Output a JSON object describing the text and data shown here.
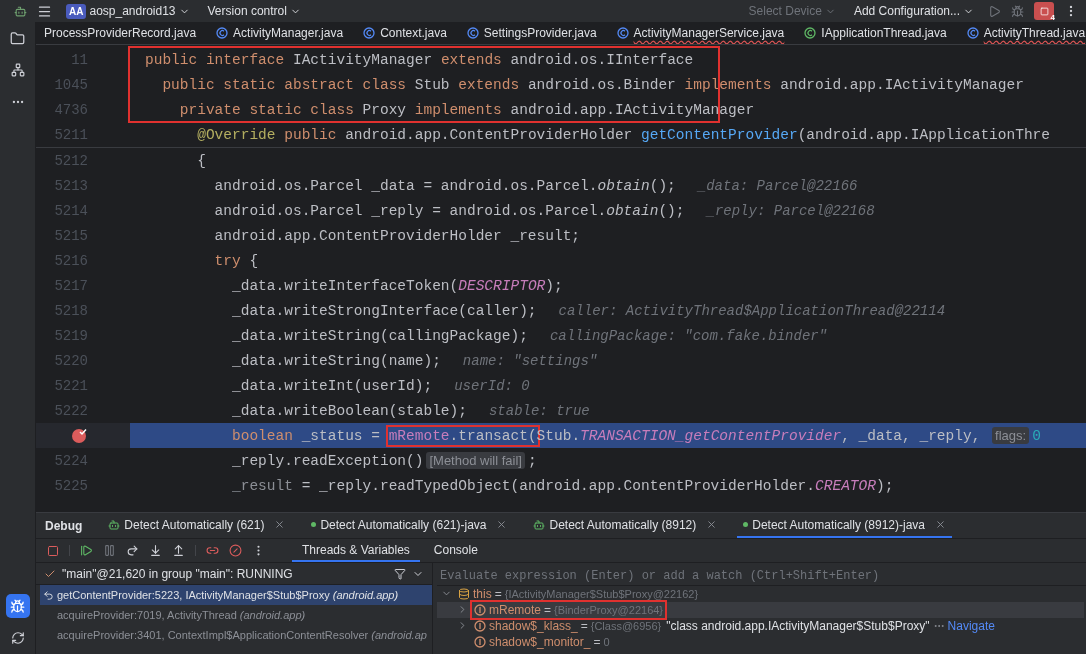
{
  "top_bar": {
    "project": {
      "badge": "AA",
      "name": "aosp_android13"
    },
    "vcs": "Version control",
    "device": {
      "label": "Select Device",
      "disabled": true
    },
    "run_config": "Add Configuration...",
    "debug_count": "4"
  },
  "file_tabs": [
    {
      "label": "ProcessProviderRecord.java",
      "kind": "none",
      "errors": false
    },
    {
      "label": "ActivityManager.java",
      "kind": "class",
      "errors": false
    },
    {
      "label": "Context.java",
      "kind": "class",
      "errors": false
    },
    {
      "label": "SettingsProvider.java",
      "kind": "class",
      "errors": false
    },
    {
      "label": "ActivityManagerService.java",
      "kind": "class",
      "errors": true
    },
    {
      "label": "IApplicationThread.java",
      "kind": "interface",
      "errors": false
    },
    {
      "label": "ActivityThread.java",
      "kind": "class",
      "errors": true
    }
  ],
  "editor": {
    "sticky_lines": [
      {
        "number": "11",
        "annotated": true,
        "tokens": [
          {
            "kind": "kw",
            "text": "public interface "
          },
          {
            "kind": "plain",
            "text": "IActivityManager "
          },
          {
            "kind": "kw",
            "text": "extends "
          },
          {
            "kind": "plain",
            "text": "android.os.IInterface"
          }
        ]
      },
      {
        "number": "1045",
        "annotated": true,
        "tokens": [
          {
            "kind": "kw",
            "text": "  public static abstract class "
          },
          {
            "kind": "plain",
            "text": "Stub "
          },
          {
            "kind": "kw",
            "text": "extends "
          },
          {
            "kind": "plain",
            "text": "android.os.Binder "
          },
          {
            "kind": "kw",
            "text": "implements "
          },
          {
            "kind": "plain",
            "text": "android.app.IActivityManager"
          }
        ]
      },
      {
        "number": "4736",
        "annotated": true,
        "tokens": [
          {
            "kind": "kw",
            "text": "    private static class "
          },
          {
            "kind": "plain",
            "text": "Proxy "
          },
          {
            "kind": "kw",
            "text": "implements "
          },
          {
            "kind": "plain",
            "text": "android.app.IActivityManager"
          }
        ]
      },
      {
        "number": "5211",
        "annotated": false,
        "tokens": [
          {
            "kind": "annotation",
            "text": "      @Override"
          },
          {
            "kind": "kw",
            "text": " public"
          },
          {
            "kind": "plain",
            "text": " android.app.ContentProviderHolder "
          },
          {
            "kind": "fn",
            "text": "getContentProvider"
          },
          {
            "kind": "plain",
            "text": "(android.app.IApplicationThre"
          }
        ]
      }
    ],
    "lines": [
      {
        "number": "5212",
        "current": false,
        "breakpoint": false,
        "tokens": [
          {
            "kind": "plain",
            "text": "      {"
          }
        ]
      },
      {
        "number": "5213",
        "current": false,
        "breakpoint": false,
        "tokens": [
          {
            "kind": "plain",
            "text": "        android.os.Parcel _data = android.os.Parcel."
          },
          {
            "kind": "static",
            "text": "obtain"
          },
          {
            "kind": "plain",
            "text": "();"
          },
          {
            "kind": "hint",
            "text": "_data: Parcel@22166"
          }
        ]
      },
      {
        "number": "5214",
        "current": false,
        "breakpoint": false,
        "tokens": [
          {
            "kind": "plain",
            "text": "        android.os.Parcel _reply = android.os.Parcel."
          },
          {
            "kind": "static",
            "text": "obtain"
          },
          {
            "kind": "plain",
            "text": "();"
          },
          {
            "kind": "hint",
            "text": "_reply: Parcel@22168"
          }
        ]
      },
      {
        "number": "5215",
        "current": false,
        "breakpoint": false,
        "tokens": [
          {
            "kind": "plain",
            "text": "        android.app.ContentProviderHolder _result;"
          }
        ]
      },
      {
        "number": "5216",
        "current": false,
        "breakpoint": false,
        "tokens": [
          {
            "kind": "kw",
            "text": "        try"
          },
          {
            "kind": "plain",
            "text": " {"
          }
        ]
      },
      {
        "number": "5217",
        "current": false,
        "breakpoint": false,
        "tokens": [
          {
            "kind": "plain",
            "text": "          _data.writeInterfaceToken("
          },
          {
            "kind": "const",
            "text": "DESCRIPTOR"
          },
          {
            "kind": "plain",
            "text": ");"
          }
        ]
      },
      {
        "number": "5218",
        "current": false,
        "breakpoint": false,
        "tokens": [
          {
            "kind": "plain",
            "text": "          _data.writeStrongInterface(caller);"
          },
          {
            "kind": "hint",
            "text": "caller: ActivityThread$ApplicationThread@22114"
          }
        ]
      },
      {
        "number": "5219",
        "current": false,
        "breakpoint": false,
        "tokens": [
          {
            "kind": "plain",
            "text": "          _data.writeString(callingPackage);"
          },
          {
            "kind": "hint",
            "text": "callingPackage: \"com.fake.binder\""
          }
        ]
      },
      {
        "number": "5220",
        "current": false,
        "breakpoint": false,
        "tokens": [
          {
            "kind": "plain",
            "text": "          _data.writeString(name);"
          },
          {
            "kind": "hint",
            "text": "name: \"settings\""
          }
        ]
      },
      {
        "number": "5221",
        "current": false,
        "breakpoint": false,
        "tokens": [
          {
            "kind": "plain",
            "text": "          _data.writeInt(userId);"
          },
          {
            "kind": "hint",
            "text": "userId: 0"
          }
        ]
      },
      {
        "number": "5222",
        "current": false,
        "breakpoint": false,
        "tokens": [
          {
            "kind": "plain",
            "text": "          _data.writeBoolean(stable);"
          },
          {
            "kind": "hint",
            "text": "stable: true"
          }
        ]
      },
      {
        "current": true,
        "breakpoint": true,
        "tokens": [
          {
            "kind": "kw",
            "text": "          boolean"
          },
          {
            "kind": "plain",
            "text": " _status = "
          },
          {
            "kind": "field",
            "text": "mRemote",
            "annotated": true
          },
          {
            "kind": "plain",
            "text": ".transact(",
            "annotated": true
          },
          {
            "kind": "plain",
            "text": "Stub."
          },
          {
            "kind": "const",
            "text": "TRANSACTION_getContentProvider"
          },
          {
            "kind": "plain",
            "text": ", _data, _reply, "
          },
          {
            "kind": "inlay",
            "text": "flags:"
          },
          {
            "kind": "number",
            "text": "0"
          }
        ]
      },
      {
        "number": "5224",
        "current": false,
        "breakpoint": false,
        "tokens": [
          {
            "kind": "plain",
            "text": "          _reply.readException()"
          },
          {
            "kind": "inlay",
            "text": "[Method will fail]"
          },
          {
            "kind": "plain",
            "text": ";"
          }
        ]
      },
      {
        "number": "5225",
        "current": false,
        "breakpoint": false,
        "tokens": [
          {
            "kind": "dim",
            "text": "          _result"
          },
          {
            "kind": "plain",
            "text": " = _reply.readTypedObject(android.app.ContentProviderHolder."
          },
          {
            "kind": "const",
            "text": "CREATOR"
          },
          {
            "kind": "plain",
            "text": ");"
          }
        ]
      }
    ]
  },
  "debug": {
    "title": "Debug",
    "sessions": [
      {
        "label": "Detect Automatically (621)",
        "kind": "android",
        "selected": false
      },
      {
        "label": "Detect Automatically (621)-java",
        "kind": "java",
        "selected": false
      },
      {
        "label": "Detect Automatically (8912)",
        "kind": "android",
        "selected": false
      },
      {
        "label": "Detect Automatically (8912)-java",
        "kind": "java",
        "selected": true
      }
    ],
    "tabs": [
      {
        "label": "Threads & Variables",
        "selected": true
      },
      {
        "label": "Console",
        "selected": false
      }
    ],
    "thread": "\"main\"@21,620 in group \"main\": RUNNING",
    "frames": [
      {
        "text": "getContentProvider:5223, IActivityManager$Stub$Proxy",
        "package": "(android.app)",
        "selected": true
      },
      {
        "text": "acquireProvider:7019, ActivityThread",
        "package": "(android.app)",
        "selected": false
      },
      {
        "text": "acquireProvider:3401, ContextImpl$ApplicationContentResolver",
        "package": "(android.ap",
        "selected": false
      }
    ],
    "evaluate_placeholder": "Evaluate expression (Enter) or add a watch (Ctrl+Shift+Enter)",
    "variables": [
      {
        "kind": "object",
        "name": "this",
        "eq": "=",
        "value": "{IActivityManager$Stub$Proxy@22162}",
        "expanded": true,
        "selected": false,
        "annotated": false,
        "children": [
          {
            "kind": "field",
            "name": "mRemote",
            "eq": "=",
            "value": "{BinderProxy@22164}",
            "expanded": false,
            "selected": true,
            "annotated": true
          },
          {
            "kind": "field",
            "name": "shadow$_klass_",
            "eq": "=",
            "value": "{Class@6956}",
            "extra": "\"class android.app.IActivityManager$Stub$Proxy\"",
            "link": "Navigate",
            "expanded": false,
            "selected": false,
            "annotated": false
          },
          {
            "kind": "leaf",
            "name": "shadow$_monitor_",
            "eq": "=",
            "value": "0",
            "selected": false,
            "annotated": false
          }
        ]
      }
    ]
  }
}
